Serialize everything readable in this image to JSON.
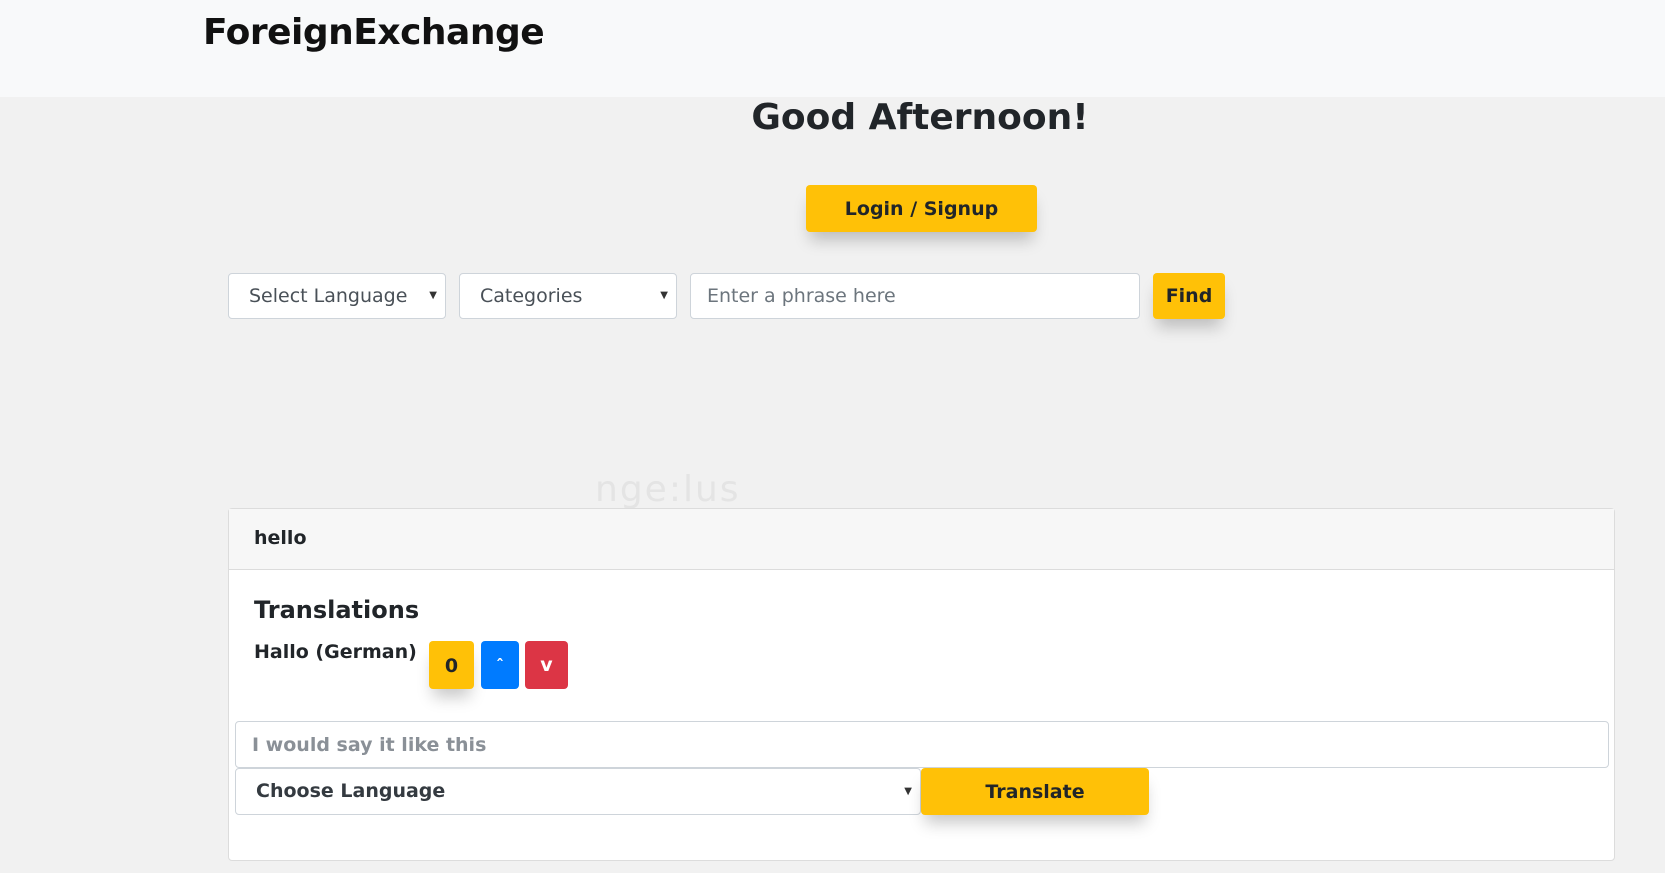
{
  "navbar": {
    "brand": "ForeignExchange"
  },
  "hero": {
    "greeting": "Good Afternoon!",
    "login_label": "Login / Signup"
  },
  "search": {
    "language_select": "Select Language",
    "category_select": "Categories",
    "phrase_placeholder": "Enter a phrase here",
    "find_label": "Find"
  },
  "watermark": "nge:lus",
  "card": {
    "header": "hello",
    "translations_title": "Translations",
    "translation": {
      "text": "Hallo (German)",
      "votes": "0",
      "upvote_label": "ˆ",
      "downvote_label": "v"
    },
    "suggest_placeholder": "I would say it like this",
    "choose_language": "Choose Language",
    "translate_label": "Translate"
  },
  "colors": {
    "accent": "#ffc107",
    "upvote": "#007bff",
    "downvote": "#dc3545",
    "navbar_bg": "#f8f9fa",
    "page_bg": "#f1f1f1"
  }
}
